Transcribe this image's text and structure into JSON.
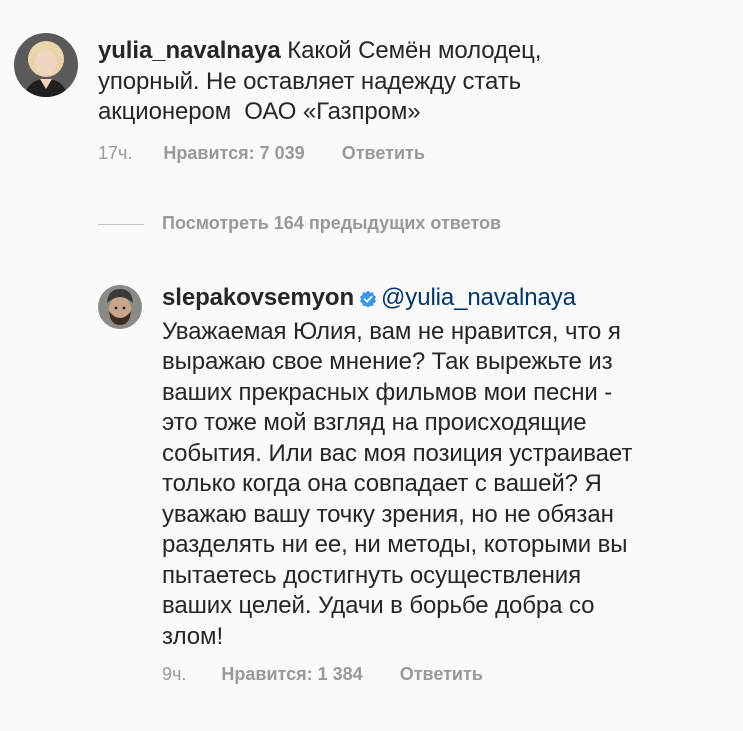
{
  "comment1": {
    "username": "yulia_navalnaya",
    "text_line1": "Какой Семён молодец,",
    "text_line2": "упорный. Не оставляет надежду стать",
    "text_line3": "акционером  ОАО «Газпром»",
    "time": "17ч.",
    "likes": "Нравится: 7 039",
    "reply": "Ответить",
    "avatar_icon": "user-avatar-woman-blonde"
  },
  "view_replies": "Посмотреть 164 предыдущих ответов",
  "comment2": {
    "username": "slepakovsemyon",
    "verified_icon": "verified-badge-icon",
    "mention": "@yulia_navalnaya",
    "lines": [
      "Уважаемая Юлия, вам не нравится, что я",
      "выражаю свое мнение? Так вырежьте из",
      "ваших прекрасных фильмов мои песни -",
      "это тоже мой взгляд на происходящие",
      "события. Или вас моя позиция устраивает",
      "только когда она совпадает с вашей? Я",
      "уважаю вашу точку зрения, но не обязан",
      "разделять ни ее, ни методы, которыми вы",
      "пытаетесь достигнуть осуществления",
      "ваших целей. Удачи в борьбе добра со",
      "злом!"
    ],
    "time": "9ч.",
    "likes": "Нравится: 1 384",
    "reply": "Ответить",
    "avatar_icon": "user-avatar-man-beard-cap"
  },
  "colors": {
    "text": "#262626",
    "meta": "#999999",
    "mention": "#003569",
    "verified": "#3897f0",
    "background": "#fafafa"
  }
}
